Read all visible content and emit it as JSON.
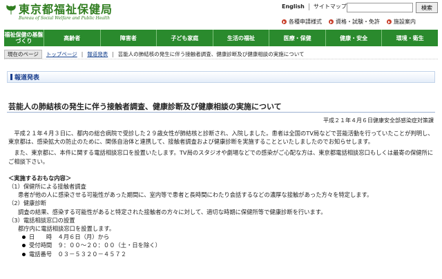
{
  "header": {
    "title": "東京都福祉保健局",
    "subtitle": "Bureau of Social Welfare and Public Health",
    "lang_link": "English",
    "sitemap_link": "サイトマップ",
    "search_placeholder": "",
    "search_button": "検索",
    "util_links": [
      "各種申請様式",
      "資格・試験・免許",
      "施設案内"
    ],
    "brand_color": "#2f7d1f"
  },
  "gnav": {
    "items": [
      "福祉保健の基盤づくり",
      "高齢者",
      "障害者",
      "子ども家庭",
      "生活の福祉",
      "医療・保健",
      "健康・安全",
      "環境・衛生"
    ],
    "color": "#2a8a2d"
  },
  "breadcrumb": {
    "here_label": "現在のページ",
    "items": [
      "トップページ",
      "報道発表",
      "芸能人の肺結核の発生に伴う接触者調査、健康診断及び健康相談の実施について"
    ]
  },
  "section": {
    "heading": "報道発表"
  },
  "article": {
    "title": "芸能人の肺結核の発生に伴う接触者調査、健康診断及び健康相談の実施について",
    "date": "平成２１年４月６日健康安全部感染症対策課",
    "para1": "平成２１年４月３日に、都内の総合病院で受診した２９歳女性が肺結核と診断され、入院しました。患者は全国のTV局などで芸能活動を行っていたことが判明し、東京都は、感染拡大の防止のために、関係自治体と連携して、接触者調査および健康診断を実施することといたしましたのでお知らせします。",
    "para2": "また、東京都に、本件に関する電話相談窓口を設置いたします。TV局のスタジオや劇場などでの感染がご心配な方は、東京都電話相談窓口もしくは最寄の保健所にご相談下さい。",
    "main_heading": "＜実施するおもな内容＞",
    "item1_title": "（1）保健所による接触者調査",
    "item1_text": "患者が他の人に感染させる可能性があった期間に、室内等で患者と長時間にわたり会話するなどの濃厚な接触があった方々を特定します。",
    "item2_title": "（2）健康診断",
    "item2_text": "調査の結果、感染する可能性があると特定された接触者の方々に対して、適切な時期に保健所等で健康診断を行います。",
    "item3_title": "（3）電話相談窓口の設置",
    "item3_text": "都庁内に電話相談窓口を設置します。",
    "d1_label": "日　　時",
    "d1_value": "４月６日（月）から",
    "d2_label": "受付時間",
    "d2_value": "９：００～２０：００（土・日を除く）",
    "d3_label": "電話番号",
    "d3_value": "０３－５３２０－４５７２"
  }
}
